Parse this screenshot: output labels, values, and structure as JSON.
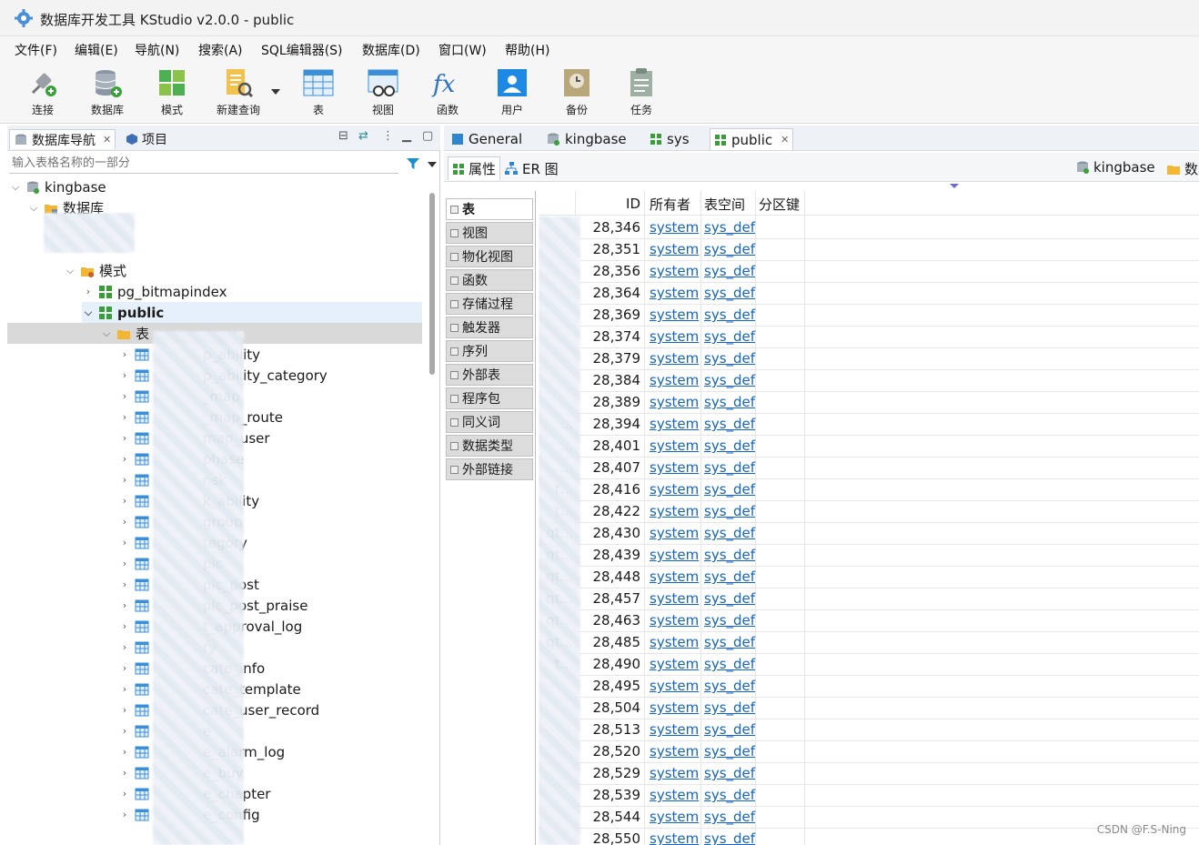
{
  "window": {
    "title": "数据库开发工具 KStudio v2.0.0 - public"
  },
  "menu": [
    "文件(F)",
    "编辑(E)",
    "导航(N)",
    "搜索(A)",
    "SQL编辑器(S)",
    "数据库(D)",
    "窗口(W)",
    "帮助(H)"
  ],
  "toolbar": {
    "connect": "连接",
    "database": "数据库",
    "schema": "模式",
    "new_query": "新建查询",
    "table": "表",
    "view": "视图",
    "function": "函数",
    "user": "用户",
    "backup": "备份",
    "task": "任务"
  },
  "left_panel": {
    "tab_navigator": "数据库导航",
    "tab_project": "项目",
    "filter_placeholder": "输入表格名称的一部分"
  },
  "tree": {
    "conn": "kingbase",
    "databases": "数据库",
    "schemas": "模式",
    "schema_a": "pg_bitmapindex",
    "schema_b": "public",
    "tables_node": "表",
    "items": [
      "p_ability",
      "p_ability_category",
      "_map",
      "_map_route",
      "map_user",
      "phase",
      "nsk",
      "k_ability",
      "group",
      "tegory",
      "pic",
      "pic_post",
      "pic_post_praise",
      "t_approval_log",
      "ry",
      "cate_info",
      "cate_template",
      "cate_user_record",
      "e",
      "e_alarm_log",
      "e_buy",
      "e_chapter",
      "e_config"
    ]
  },
  "editor_tabs": [
    "General",
    "kingbase",
    "sys",
    "public"
  ],
  "sub_tabs": {
    "properties": "属性",
    "er": "ER 图"
  },
  "crumbs": {
    "conn": "kingbase",
    "db": "数"
  },
  "object_types": [
    "表",
    "视图",
    "物化视图",
    "函数",
    "存储过程",
    "触发器",
    "序列",
    "外部表",
    "程序包",
    "同义词",
    "数据类型",
    "外部链接"
  ],
  "grid": {
    "headers": {
      "id": "ID",
      "owner": "所有者",
      "tablespace": "表空间",
      "partition_key": "分区键"
    },
    "name_fragments": [
      "",
      "",
      "",
      "",
      "",
      "",
      "",
      "",
      "",
      "...",
      "...",
      "...",
      "t...",
      "t...",
      "qt...",
      "qt...",
      "qt...",
      "qt...",
      "qt...",
      "qt...",
      "t...",
      "",
      "",
      "",
      "",
      "",
      "",
      ""
    ],
    "ids": [
      "28,346",
      "28,351",
      "28,356",
      "28,364",
      "28,369",
      "28,374",
      "28,379",
      "28,384",
      "28,389",
      "28,394",
      "28,401",
      "28,407",
      "28,416",
      "28,422",
      "28,430",
      "28,439",
      "28,448",
      "28,457",
      "28,463",
      "28,485",
      "28,490",
      "28,495",
      "28,504",
      "28,513",
      "28,520",
      "28,529",
      "28,539",
      "28,544",
      "28,550"
    ],
    "owner": "system",
    "tablespace": "sys_def"
  },
  "watermark": "CSDN @F.S-Ning",
  "colors": {
    "accent": "#1565c0",
    "folder": "#f2b632",
    "schema_green": "#3a9d3a"
  }
}
